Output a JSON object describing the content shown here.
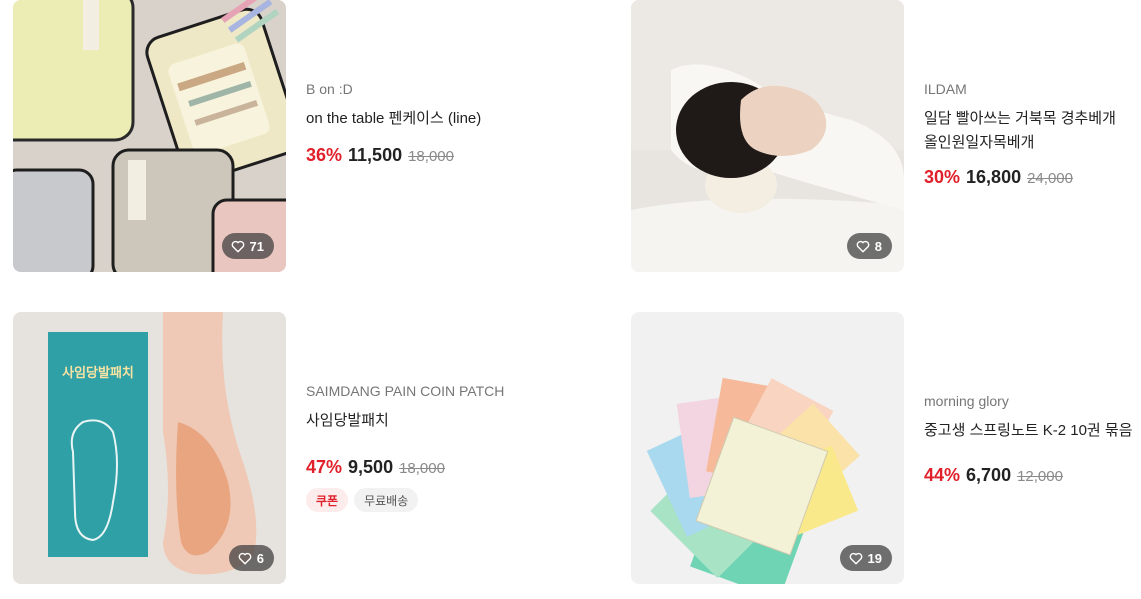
{
  "products": [
    {
      "brand": "B on :D",
      "name": "on the table 펜케이스 (line)",
      "discount": "36%",
      "price": "11,500",
      "original_price": "18,000",
      "likes": "71",
      "image": "pencil-cases"
    },
    {
      "brand": "ILDAM",
      "name": "일담 빨아쓰는 거북목 경추베개 올인원일자목베개",
      "discount": "30%",
      "price": "16,800",
      "original_price": "24,000",
      "likes": "8",
      "image": "neck-pillow"
    },
    {
      "brand": "SAIMDANG PAIN COIN PATCH",
      "name": "사임당발패치",
      "discount": "47%",
      "price": "9,500",
      "original_price": "18,000",
      "likes": "6",
      "tags": [
        "쿠폰",
        "무료배송"
      ],
      "image": "foot-patch",
      "package_title": "사임당발패치"
    },
    {
      "brand": "morning glory",
      "name": "중고생 스프링노트 K-2 10권 묶음",
      "discount": "44%",
      "price": "6,700",
      "original_price": "12,000",
      "likes": "19",
      "image": "spring-notes"
    }
  ],
  "colors": {
    "discount": "#e0202a",
    "badge_bg": "#3c3c3c"
  }
}
